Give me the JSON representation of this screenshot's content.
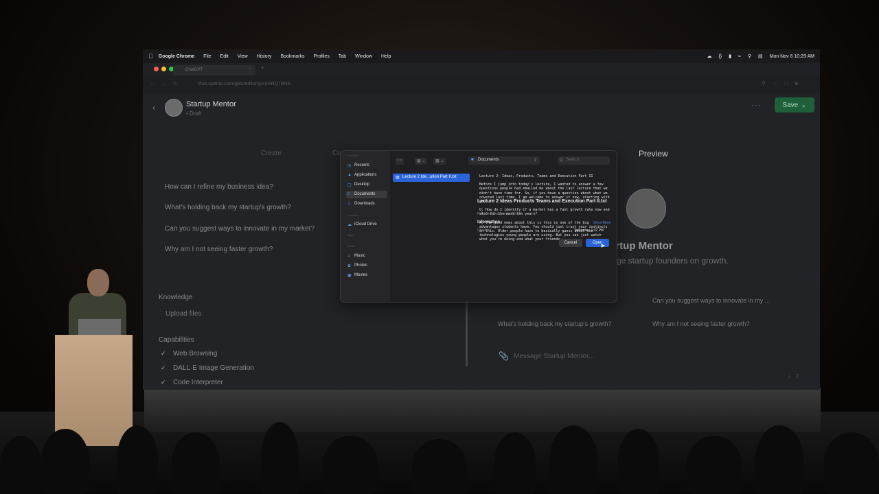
{
  "menubar": {
    "app": "Google Chrome",
    "items": [
      "File",
      "Edit",
      "View",
      "History",
      "Bookmarks",
      "Profiles",
      "Tab",
      "Window",
      "Help"
    ],
    "datetime": "Mon Nov 6  10:29 AM"
  },
  "browser": {
    "tab_title": "ChatGPT",
    "url": "chat.openai.com/gpts/editor/g-c5RRQ7BNK"
  },
  "gpt": {
    "name": "Startup Mentor",
    "status": "• Draft",
    "save_label": "Save"
  },
  "editor": {
    "tabs": {
      "create": "Create",
      "configure": "Co",
      "preview": "Preview"
    },
    "conversation_starters": [
      "How can I refine my business idea?",
      "What's holding back my startup's growth?",
      "Can you suggest ways to innovate in my market?",
      "Why am I not seeing faster growth?"
    ],
    "knowledge_label": "Knowledge",
    "upload_label": "Upload files",
    "capabilities_label": "Capabilities",
    "capabilities": [
      "Web Browsing",
      "DALL·E Image Generation",
      "Code Interpreter"
    ]
  },
  "preview": {
    "name": "artup Mentor",
    "description": "ge startup founders on growth.",
    "chips": [
      "Can you suggest ways to innovate in my ...",
      "What's holding back my startup's growth?",
      "Why am I not seeing faster growth?"
    ],
    "message_placeholder": "Message Startup Mentor..."
  },
  "file_dialog": {
    "sidebar_groups": [
      "Favorites",
      "Locations",
      "Tags",
      "Media"
    ],
    "sidebar_items": [
      "Recents",
      "Applications",
      "Desktop",
      "Documents",
      "Downloads",
      "iCloud Drive",
      "Music",
      "Photos",
      "Movies"
    ],
    "location": "Documents",
    "search_placeholder": "Search",
    "selected_file": "Lecture 2 Ide...ution Part II.txt",
    "preview_heading": "Lecture 2: Ideas, Products, Teams and Execution Part II",
    "preview_para1": "Before I jump into today's lecture, I wanted to answer a few questions people had emailed me about the last lecture that we didn't have time for. So, if you have a question about what we covered last time, I am welcome to answer it now, starting with you.",
    "preview_para2": "Q: How do I identify if a market has a fast growth rate now and also for the next ten years?",
    "preview_para3": "A: The good news about this is this is one of the big advantages students have. You should just trust your instincts on this. Older people have to basically guess about the technologies young people are using. But you can just watch what you're doing and what your friends",
    "file_name": "Lecture 2 Ideas Products Teams and Execution Part II.txt",
    "file_meta": "Plain Text Document - 29 KB",
    "info_title": "Information",
    "show_more": "Show More",
    "created_label": "Created",
    "created_value": "Yesterday, 1:32 PM",
    "cancel_label": "Cancel",
    "open_label": "Open"
  },
  "colors": {
    "save": "#1f5f3a",
    "accent": "#2a64d8",
    "background": "#222326"
  }
}
